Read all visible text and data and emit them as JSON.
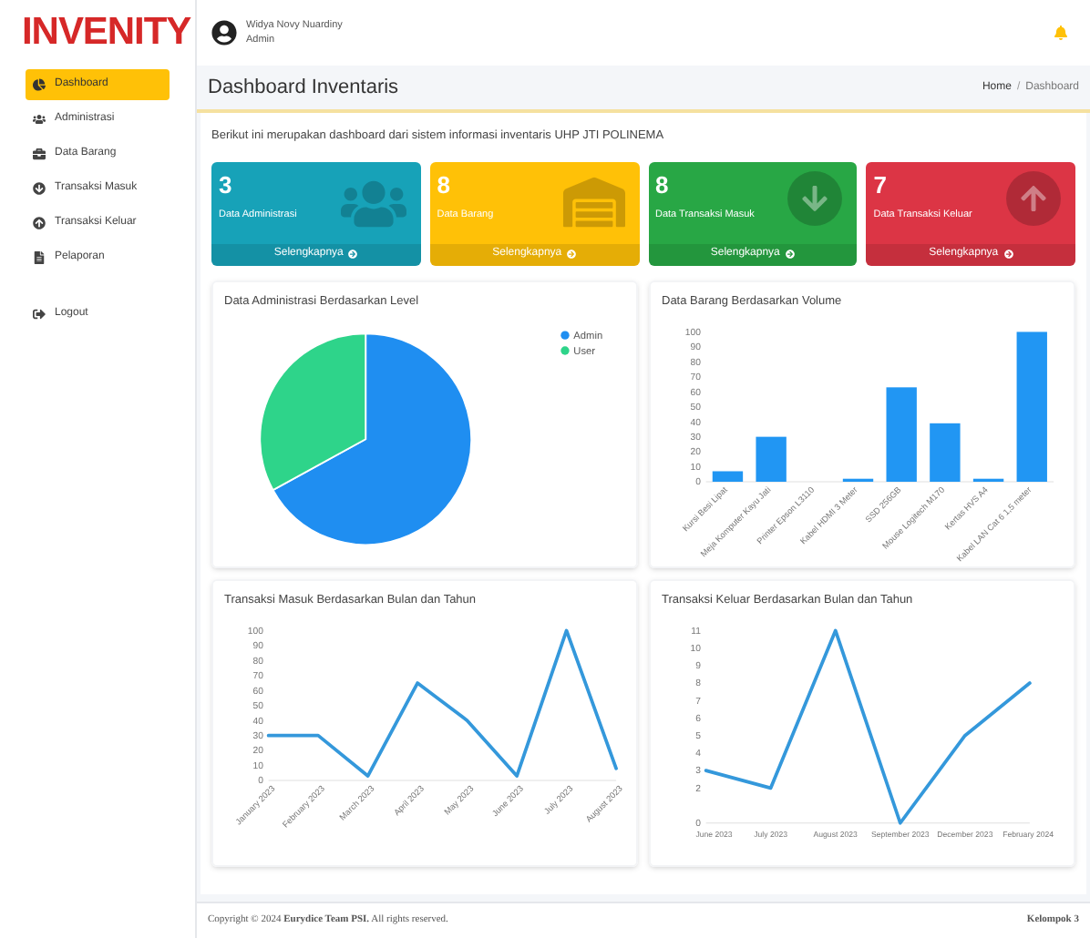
{
  "brand": {
    "logo": "INVENITY"
  },
  "user": {
    "name": "Widya Novy Nuardiny",
    "role": "Admin"
  },
  "sidebar": {
    "items": [
      {
        "label": "Dashboard",
        "selected": true
      },
      {
        "label": "Administrasi",
        "selected": false
      },
      {
        "label": "Data Barang",
        "selected": false
      },
      {
        "label": "Transaksi Masuk",
        "selected": false
      },
      {
        "label": "Transaksi Keluar",
        "selected": false
      },
      {
        "label": "Pelaporan",
        "selected": false
      }
    ],
    "logout": "Logout"
  },
  "page": {
    "title": "Dashboard Inventaris",
    "breadcrumb": [
      "Home",
      "Dashboard"
    ],
    "breadcrumb_separator": "/",
    "intro": "Berikut ini merupakan dashboard dari sistem informasi inventaris UHP JTI POLINEMA"
  },
  "stat_cards": [
    {
      "value": "3",
      "label": "Data Administrasi",
      "link": "Selengkapnya",
      "color": "#17a2b8"
    },
    {
      "value": "8",
      "label": "Data Barang",
      "link": "Selengkapnya",
      "color": "#ffc107"
    },
    {
      "value": "8",
      "label": "Data Transaksi Masuk",
      "link": "Selengkapnya",
      "color": "#28a745"
    },
    {
      "value": "7",
      "label": "Data Transaksi Keluar",
      "link": "Selengkapnya",
      "color": "#dc3545"
    }
  ],
  "charts": [
    {
      "title": "Data Administrasi Berdasarkan Level",
      "chart_data": {
        "type": "pie",
        "categories": [
          "Admin",
          "User"
        ],
        "legend": "right",
        "series": [
          {
            "values": [
              67,
              33
            ]
          }
        ]
      }
    },
    {
      "title": "Data Barang Berdasarkan Volume",
      "chart_data": {
        "type": "bar",
        "categories": [
          "Kursi Besi Lipat",
          "Meja Komputer Kayu Jati",
          "Printer Epson L3110",
          "Kabel HDMI 3 Meter",
          "SSD 256GB",
          "Mouse Logitech M170",
          "Kertas HVS A4",
          "Kabel LAN Cat 6 1,5 meter"
        ],
        "series": [
          {
            "color": "#2196f3",
            "values": [
              7,
              30,
              0,
              2,
              63,
              39,
              2,
              100
            ]
          }
        ],
        "ylim": [
          0,
          100
        ],
        "yticks": [
          0,
          10,
          20,
          30,
          40,
          50,
          60,
          70,
          80,
          90,
          100
        ]
      }
    },
    {
      "title": "Transaksi Masuk Berdasarkan Bulan dan Tahun",
      "chart_data": {
        "type": "line",
        "categories": [
          "January 2023",
          "February 2023",
          "March 2023",
          "April 2023",
          "May 2023",
          "June 2023",
          "July 2023",
          "August 2023"
        ],
        "series": [
          {
            "color": "#3498db",
            "values": [
              30,
              30,
              3,
              65,
              40,
              3,
              100,
              8
            ]
          }
        ],
        "ylim": [
          0,
          100
        ],
        "yticks": [
          0,
          10,
          20,
          30,
          40,
          50,
          60,
          70,
          80,
          90,
          100
        ]
      }
    },
    {
      "title": "Transaksi Keluar Berdasarkan Bulan dan Tahun",
      "chart_data": {
        "type": "line",
        "categories": [
          "June 2023",
          "July 2023",
          "August 2023",
          "September 2023",
          "December 2023",
          "February 2024"
        ],
        "series": [
          {
            "color": "#3498db",
            "values": [
              3,
              2,
              11,
              0,
              5,
              8
            ]
          }
        ],
        "ylim": [
          0,
          11
        ],
        "yticks": [
          0,
          2,
          3,
          4,
          5,
          6,
          7,
          8,
          9,
          10,
          11
        ]
      }
    }
  ],
  "footer": {
    "copyright": "Copyright © 2024 **Eurydice Team PSI.** All rights reserved.",
    "right": "Kelompok 3"
  }
}
